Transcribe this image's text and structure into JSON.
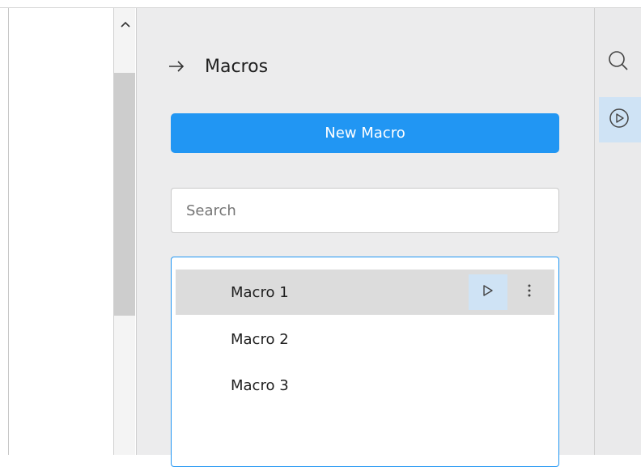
{
  "panel": {
    "title": "Macros",
    "new_macro_label": "New Macro",
    "search_placeholder": "Search",
    "macros": [
      {
        "label": "Macro 1",
        "selected": true
      },
      {
        "label": "Macro 2",
        "selected": false
      },
      {
        "label": "Macro 3",
        "selected": false
      }
    ]
  },
  "icons": {
    "back": "arrow-right-icon",
    "scroll_up": "chevron-up-icon",
    "run": "play-outline-icon",
    "more": "vertical-ellipsis-icon",
    "rail_search": "search-icon",
    "rail_macros": "play-circle-icon"
  },
  "colors": {
    "accent": "#2196f3",
    "selected_row": "#dcdcdc",
    "highlight": "#cfe3f5",
    "panel_bg": "#ececed"
  }
}
